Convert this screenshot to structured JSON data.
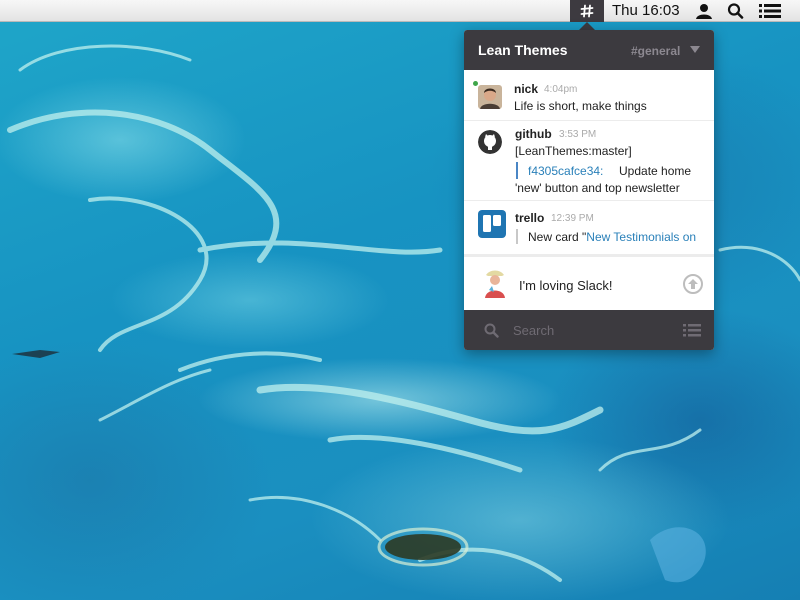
{
  "menubar": {
    "clock": "Thu 16:03",
    "icons": [
      "slack-hash-icon",
      "user-icon",
      "search-icon",
      "notification-list-icon"
    ]
  },
  "popover": {
    "team_name": "Lean Themes",
    "channel": "#general",
    "messages": [
      {
        "author": "nick",
        "time": "4:04pm",
        "lines": [
          "Life is short, make things"
        ],
        "online": true
      },
      {
        "author": "github",
        "time": "3:53 PM",
        "lines": [
          "[LeanThemes:master]"
        ],
        "commit_hash": "f4305cafce34:",
        "commit_message": "Update home",
        "commit_message_2": "'new' button and top newsletter"
      },
      {
        "author": "trello",
        "time": "12:39 PM",
        "attachment_prefix": "New card \"",
        "attachment_link": "New Testimonials on"
      }
    ],
    "composer_text": "I'm loving Slack!",
    "search_placeholder": "Search"
  },
  "colors": {
    "sidebar_dark": "#3c3a3f",
    "link": "#2a80b9",
    "presence": "#3fa64a",
    "attachment_bar": "#4a86c5"
  }
}
